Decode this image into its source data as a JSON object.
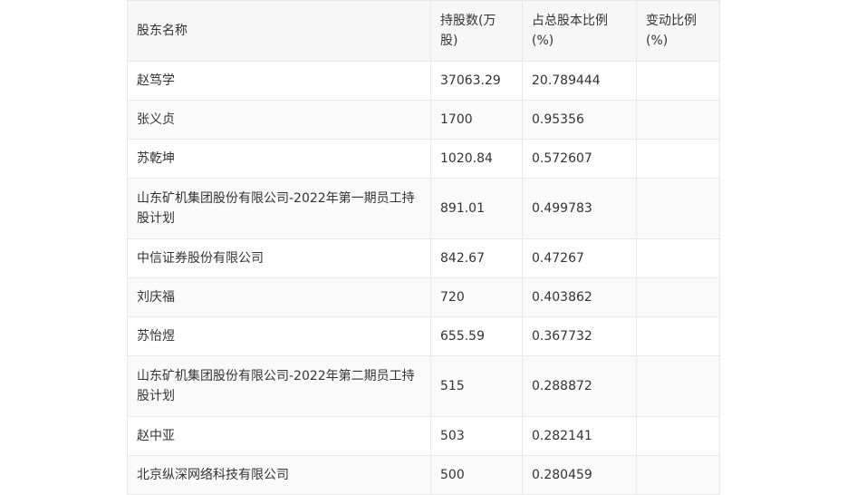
{
  "table": {
    "headers": [
      "股东名称",
      "持股数(万股)",
      "占总股本比例(%)",
      "变动比例(%)"
    ],
    "rows": [
      [
        "赵笃学",
        "37063.29",
        "20.789444",
        ""
      ],
      [
        "张义贞",
        "1700",
        "0.95356",
        ""
      ],
      [
        "苏乾坤",
        "1020.84",
        "0.572607",
        ""
      ],
      [
        "山东矿机集团股份有限公司-2022年第一期员工持股计划",
        "891.01",
        "0.499783",
        ""
      ],
      [
        "中信证券股份有限公司",
        "842.67",
        "0.47267",
        ""
      ],
      [
        "刘庆福",
        "720",
        "0.403862",
        ""
      ],
      [
        "苏怡煜",
        "655.59",
        "0.367732",
        ""
      ],
      [
        "山东矿机集团股份有限公司-2022年第二期员工持股计划",
        "515",
        "0.288872",
        ""
      ],
      [
        "赵中亚",
        "503",
        "0.282141",
        ""
      ],
      [
        "北京纵深网络科技有限公司",
        "500",
        "0.280459",
        ""
      ]
    ]
  }
}
